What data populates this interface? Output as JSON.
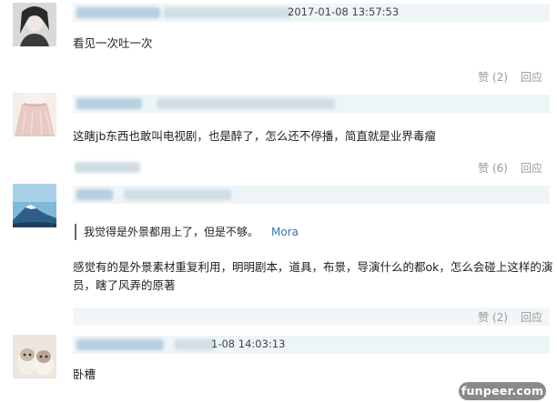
{
  "comments": [
    {
      "timestamp": "2017-01-08 13:57:53",
      "text": "看见一次吐一次",
      "like_label": "赞",
      "like_count": "(2)",
      "reply_label": "回应"
    },
    {
      "text": "这瞎jb东西也敢叫电视剧，也是醉了，怎么还不停播，简直就是业界毒瘤",
      "like_label": "赞",
      "like_count": "(6)",
      "reply_label": "回应"
    },
    {
      "quote_text": "我觉得是外景都用上了，但是不够。",
      "quote_author": "Mora",
      "text_line1": "感觉有的是外景素材重复利用，明明剧本，道具，布景，导演什么的都ok，怎么会碰上这样的演",
      "text_line2": "员，瞎了风弄的原著",
      "like_label": "赞",
      "like_count": "(2)",
      "reply_label": "回应"
    },
    {
      "timestamp": "1-08 14:03:13",
      "text": "卧槽"
    }
  ],
  "watermark": "funpeer.com"
}
